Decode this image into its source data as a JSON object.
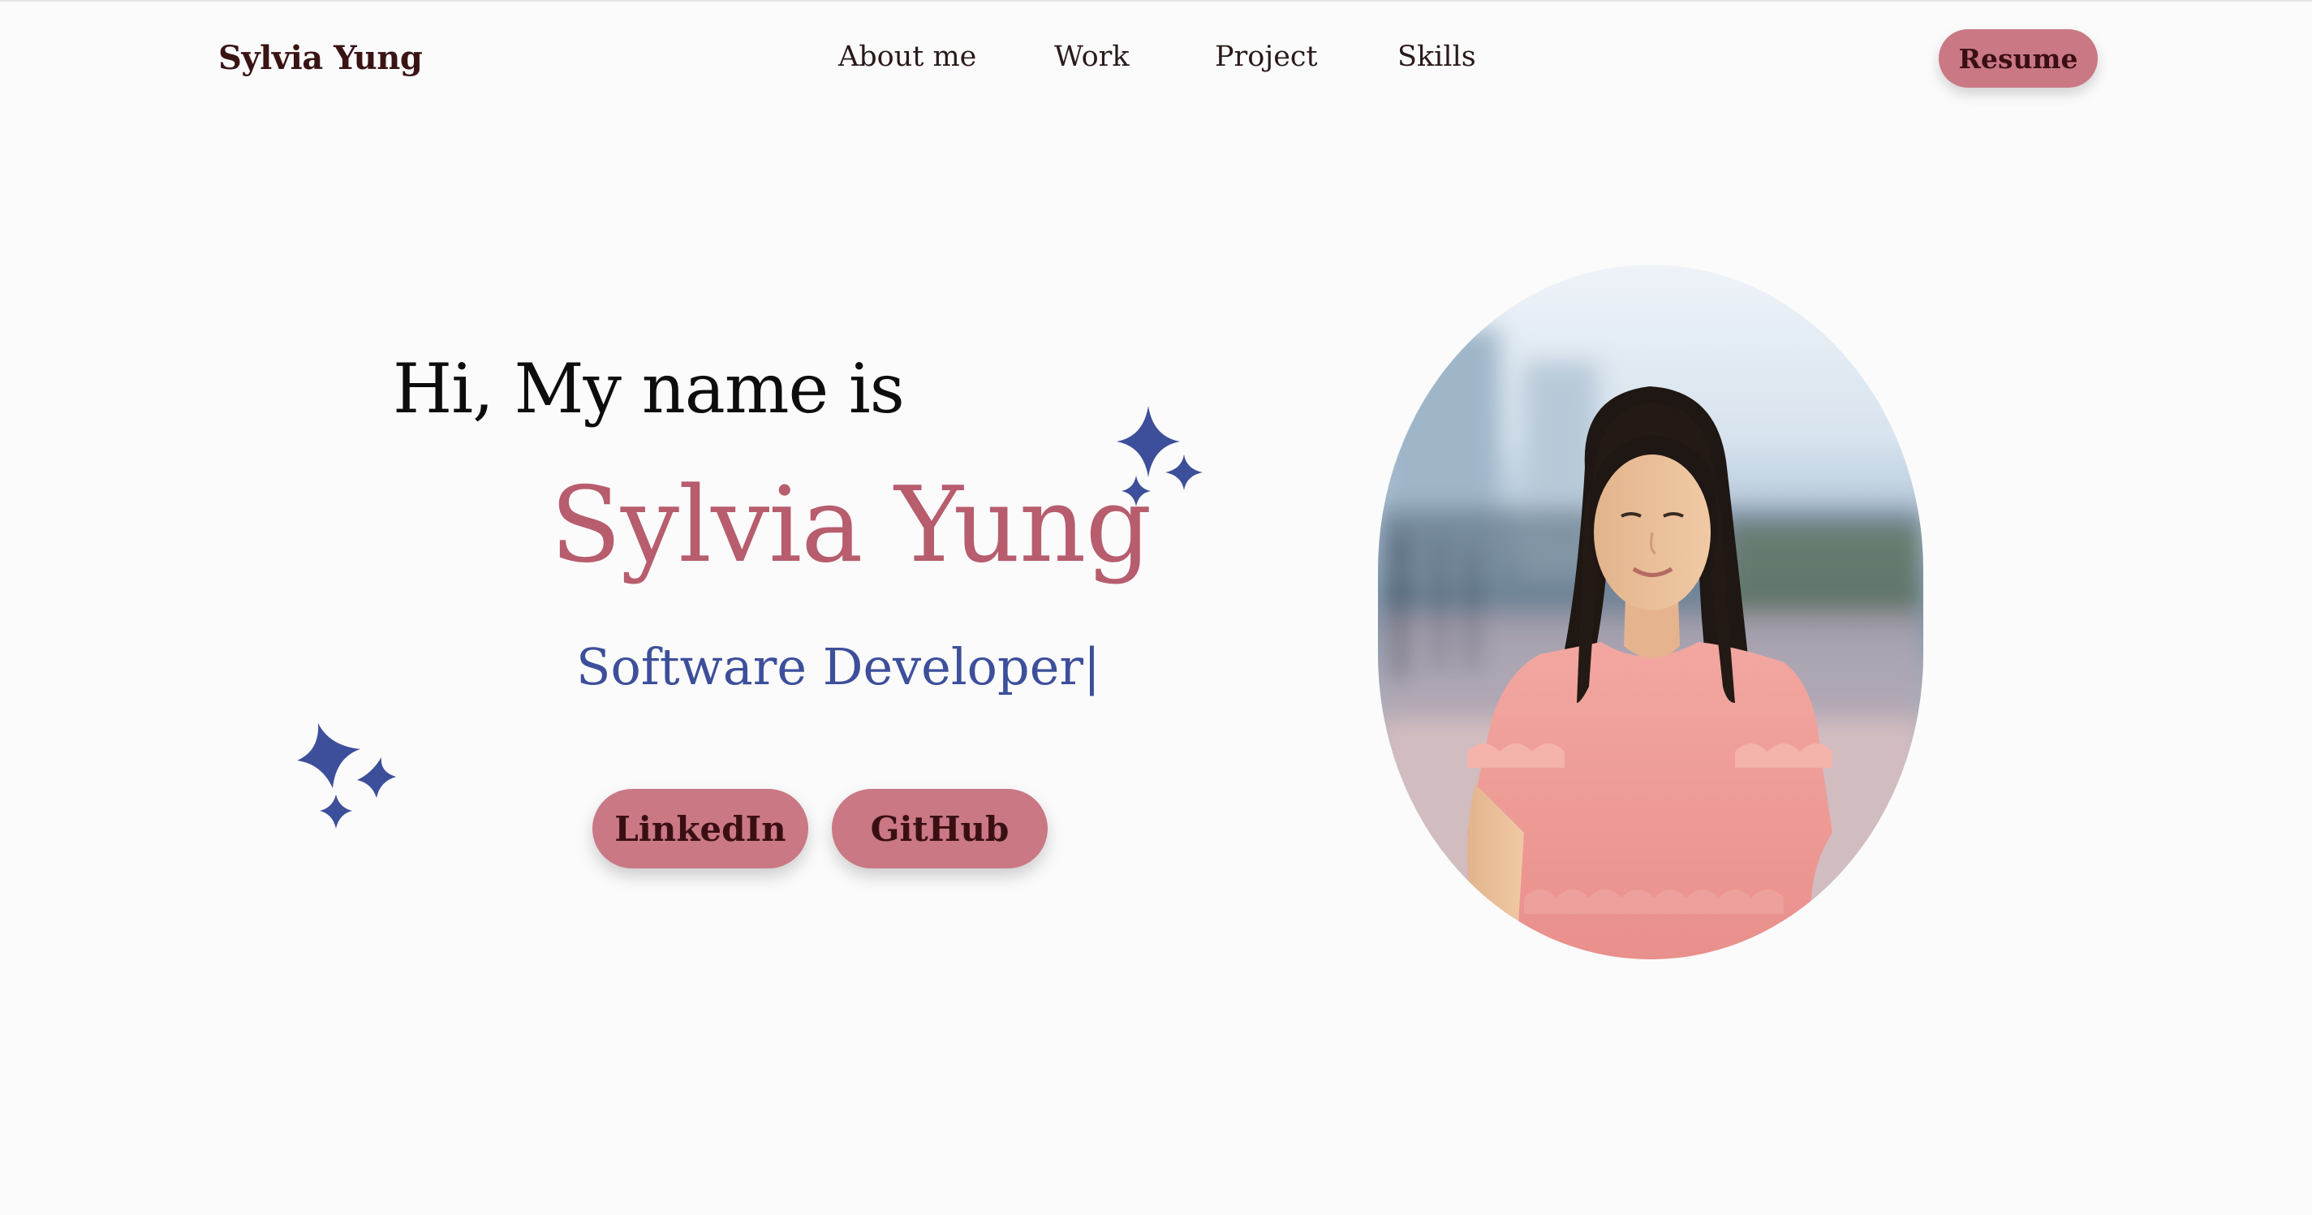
{
  "nav": {
    "brand": "Sylvia Yung",
    "items": [
      {
        "label": "About me"
      },
      {
        "label": "Work"
      },
      {
        "label": "Project"
      },
      {
        "label": "Skills"
      }
    ],
    "resume_label": "Resume"
  },
  "hero": {
    "greeting": "Hi, My name is",
    "name": "Sylvia Yung",
    "role": "Software Developer|",
    "buttons": {
      "linkedin": "LinkedIn",
      "github": "GitHub"
    }
  },
  "icons": {
    "sparkle": "sparkle-icon"
  },
  "colors": {
    "accent": "#c97884",
    "name": "#b75d6e",
    "role": "#3d4f9a",
    "sparkle": "#3d4f9a",
    "background": "#fbfbfb"
  }
}
